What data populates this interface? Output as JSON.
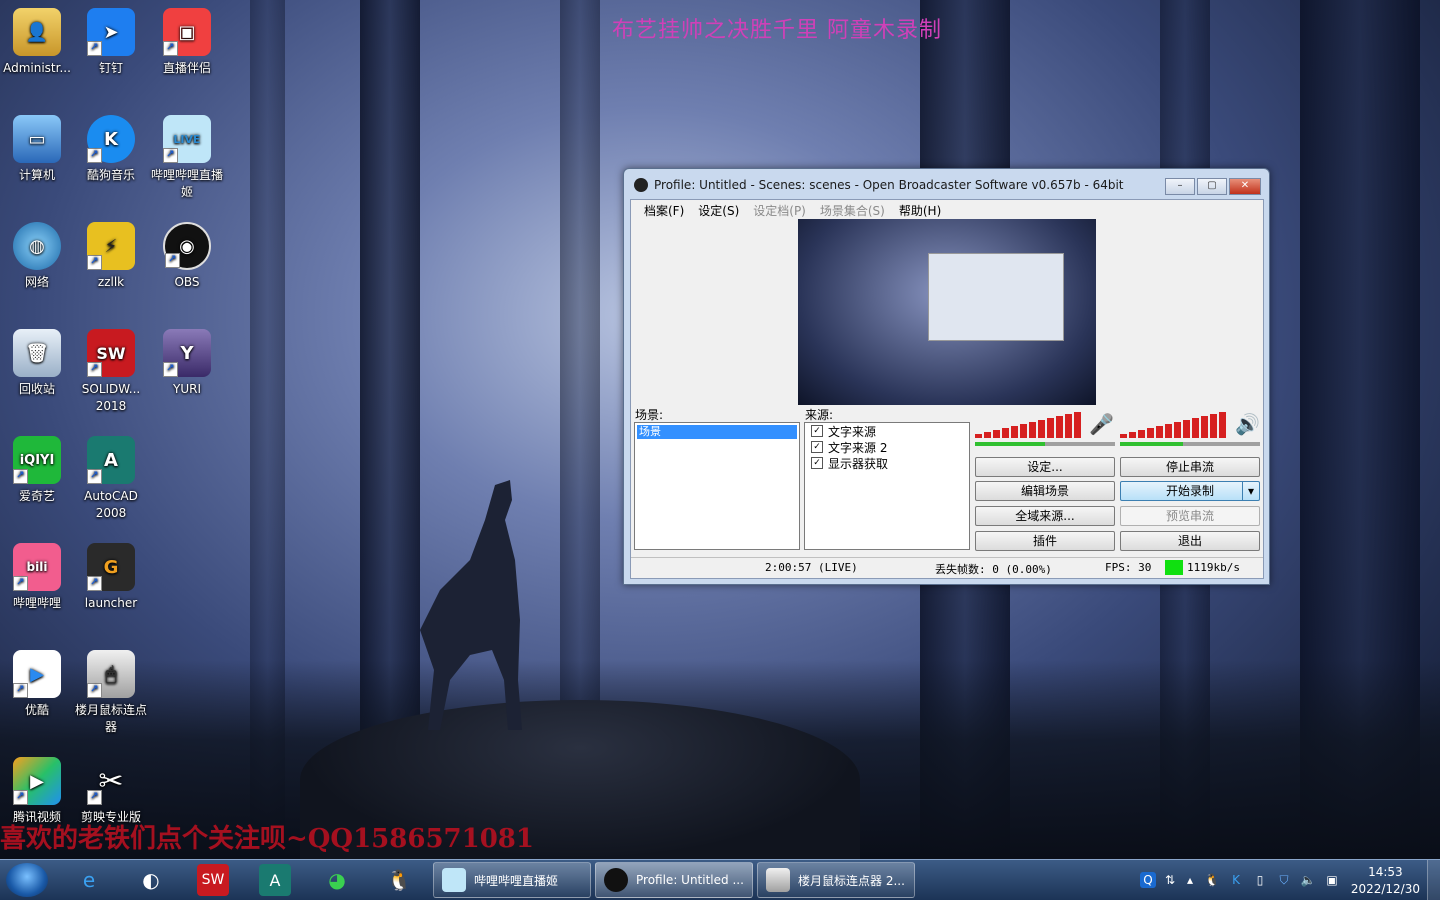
{
  "watermark_top": "布艺挂帅之决胜千里  阿童木录制",
  "watermark_bottom": "喜欢的老铁们点个关注呗~QQ1586571081",
  "desktop_icons": [
    {
      "label": "Administr..."
    },
    {
      "label": "钉钉"
    },
    {
      "label": "直播伴侣"
    },
    {
      "label": "计算机"
    },
    {
      "label": "酷狗音乐"
    },
    {
      "label": "哔哩哔哩直播姬"
    },
    {
      "label": "网络"
    },
    {
      "label": "zzllk"
    },
    {
      "label": "OBS"
    },
    {
      "label": "回收站"
    },
    {
      "label": "SOLIDW... 2018"
    },
    {
      "label": "YURI"
    },
    {
      "label": "爱奇艺"
    },
    {
      "label": "AutoCAD 2008"
    },
    {
      "label": "哔哩哔哩"
    },
    {
      "label": "launcher"
    },
    {
      "label": "优酷"
    },
    {
      "label": "楼月鼠标连点器"
    },
    {
      "label": "腾讯视频"
    },
    {
      "label": "剪映专业版"
    }
  ],
  "obs": {
    "title": "Profile: Untitled - Scenes: scenes - Open Broadcaster Software v0.657b - 64bit",
    "menu": [
      "档案(F)",
      "设定(S)",
      "设定档(P)",
      "场景集合(S)",
      "帮助(H)"
    ],
    "scenes_label": "场景:",
    "scenes": [
      "场景"
    ],
    "sources_label": "来源:",
    "sources": [
      "文字来源",
      "文字来源 2",
      "显示器获取"
    ],
    "buttons": {
      "settings": "设定...",
      "stop_stream": "停止串流",
      "edit_scene": "编辑场景",
      "start_record": "开始录制",
      "global_sources": "全域来源...",
      "preview_stream": "预览串流",
      "plugins": "插件",
      "exit": "退出"
    },
    "status": {
      "time": "2:00:57 (LIVE)",
      "dropped": "丢失帧数: 0 (0.00%)",
      "fps": "FPS: 30",
      "bitrate": "1119kb/s"
    },
    "mic_level": 0.5,
    "desktop_level": 0.45
  },
  "taskbar": {
    "tasks": [
      "哔哩哔哩直播姬",
      "Profile: Untitled ...",
      "楼月鼠标连点器 2..."
    ],
    "time": "14:53",
    "date": "2022/12/30"
  }
}
